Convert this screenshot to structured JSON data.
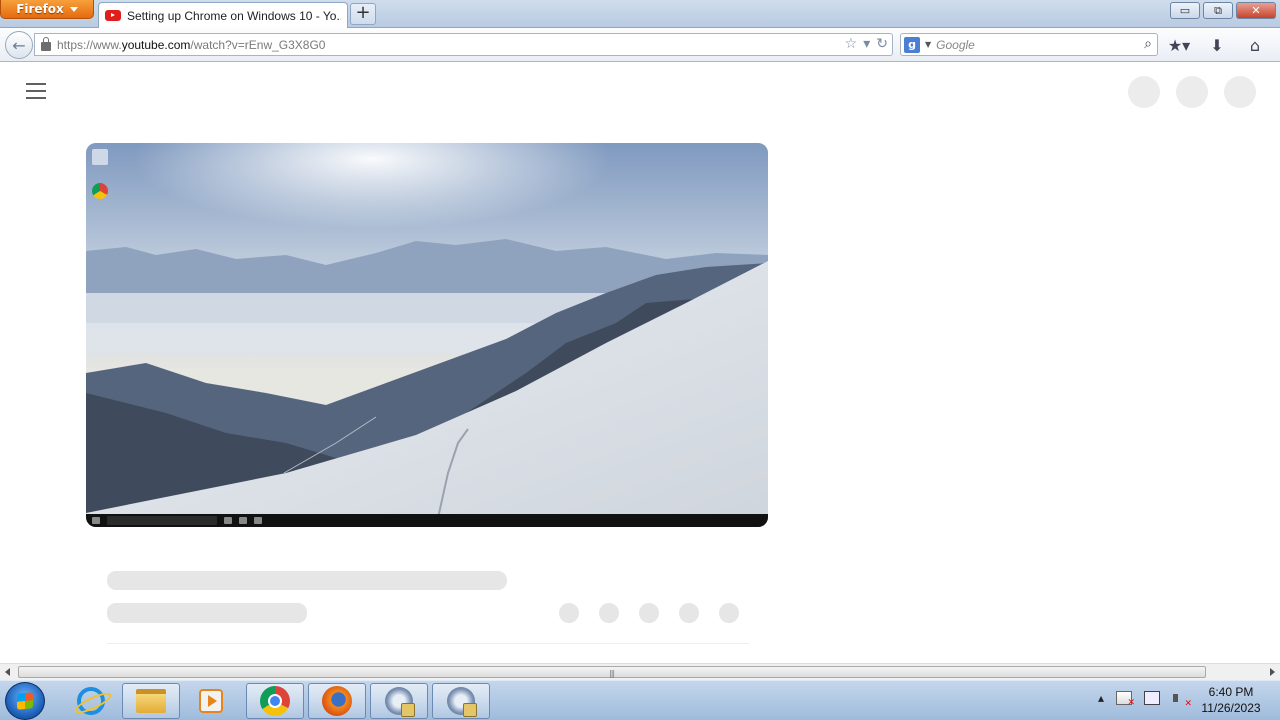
{
  "browser": {
    "app_button_label": "Firefox",
    "tab": {
      "title": "Setting up Chrome on Windows 10 - Yo..."
    },
    "new_tab_label": "+",
    "window_controls": {
      "minimize": "▭",
      "restore": "⧉",
      "close": "✕"
    },
    "url": {
      "prefix": "https://www.",
      "domain": "youtube.com",
      "path": "/watch?v=rEnw_G3X8G0"
    },
    "search": {
      "engine": "Google",
      "placeholder": "Google"
    }
  },
  "icons": {
    "back": "arrow-left-icon",
    "lock": "lock-icon",
    "bookmark_star": "star-icon",
    "history_dropdown": "chevron-down-icon",
    "reload": "reload-icon",
    "search_engine": "google-icon",
    "search_go": "magnifier-icon",
    "bookmarks_menu": "bookmarks-icon",
    "downloads": "download-icon",
    "home": "home-icon"
  },
  "page": {
    "header_circles": 3,
    "video": {
      "desktop_icons": [
        "recycle-bin-icon",
        "chrome-icon"
      ]
    },
    "action_dots": 5
  },
  "taskbar": {
    "items": [
      "internet-explorer",
      "file-explorer",
      "media-player",
      "chrome",
      "firefox",
      "chrome-setup",
      "chrome-setup"
    ],
    "clock": {
      "time": "6:40 PM",
      "date": "11/26/2023"
    }
  },
  "colors": {
    "youtube_red": "#e01e1e",
    "firefox_orange": "#e56b0f",
    "skeleton": "#e6e6e6"
  }
}
